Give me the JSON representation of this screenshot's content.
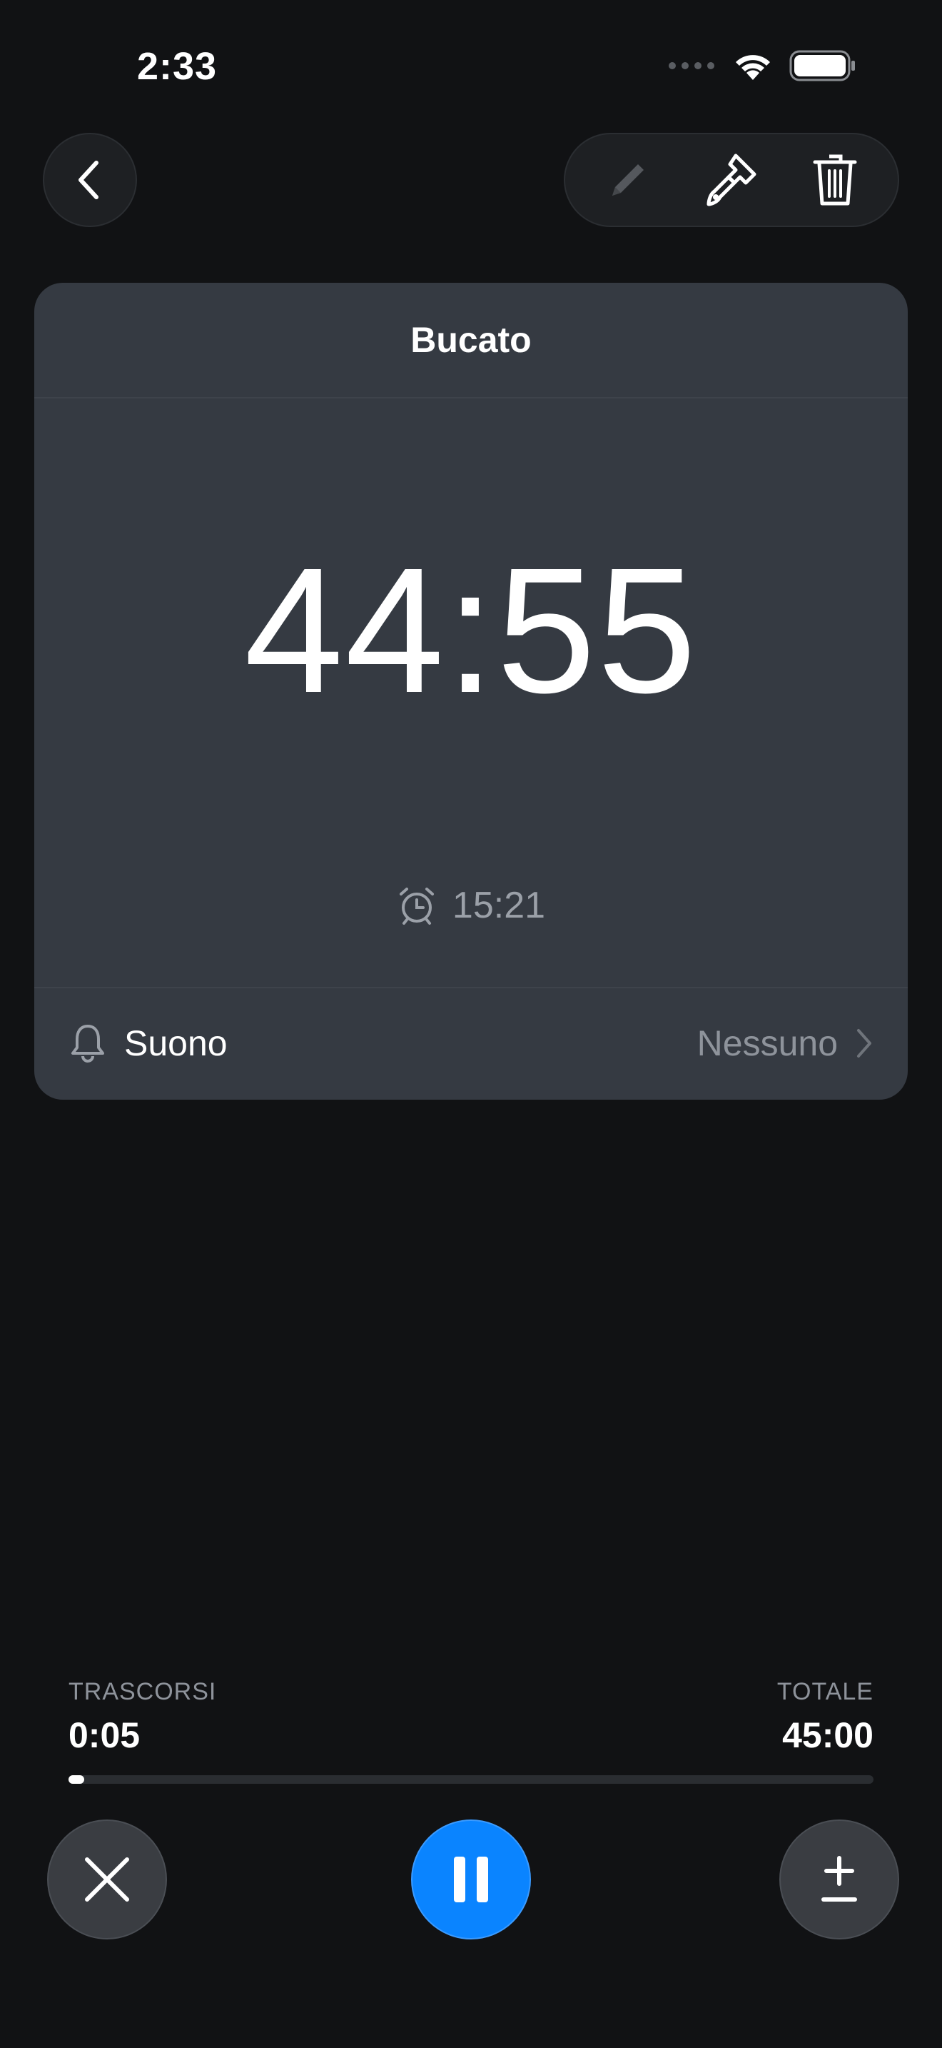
{
  "status_bar": {
    "time": "2:33"
  },
  "timer": {
    "title": "Bucato",
    "remaining": "44:55",
    "end_time": "15:21"
  },
  "sound": {
    "label": "Suono",
    "value": "Nessuno"
  },
  "progress": {
    "elapsed_label": "TRASCORSI",
    "elapsed_value": "0:05",
    "total_label": "TOTALE",
    "total_value": "45:00",
    "fraction": 0.0019
  },
  "icons": {
    "back": "chevron-left-icon",
    "edit": "pencil-icon",
    "theme": "paintbrush-icon",
    "delete": "trash-icon",
    "alarm": "alarm-clock-icon",
    "bell": "bell-icon",
    "chevron": "chevron-right-icon",
    "cancel": "close-icon",
    "pause": "pause-icon",
    "adjust": "plus-minus-icon"
  },
  "colors": {
    "background": "#111214",
    "card": "#353a42",
    "accent": "#0a84ff"
  }
}
